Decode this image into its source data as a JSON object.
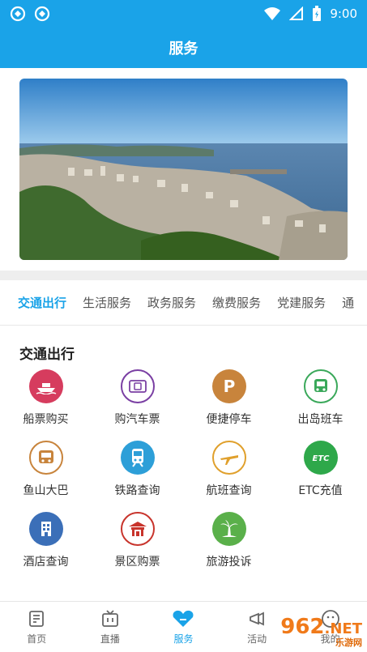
{
  "status": {
    "time": "9:00"
  },
  "header": {
    "title": "服务"
  },
  "tabs": [
    "交通出行",
    "生活服务",
    "政务服务",
    "缴费服务",
    "党建服务",
    "通"
  ],
  "section": {
    "title": "交通出行"
  },
  "services": [
    {
      "label": "船票购买",
      "icon": "ship-icon",
      "color": "#d63c5e"
    },
    {
      "label": "购汽车票",
      "icon": "bus-ticket-icon",
      "color": "#7a3fa3"
    },
    {
      "label": "便捷停车",
      "icon": "parking-icon",
      "color": "#c8843c"
    },
    {
      "label": "出岛班车",
      "icon": "shuttle-bus-icon",
      "color": "#3aa85a"
    },
    {
      "label": "鱼山大巴",
      "icon": "coach-icon",
      "color": "#c8843c"
    },
    {
      "label": "铁路查询",
      "icon": "train-icon",
      "color": "#2d9fd8"
    },
    {
      "label": "航班查询",
      "icon": "plane-icon",
      "color": "#e0a02c"
    },
    {
      "label": "ETC充值",
      "icon": "etc-icon",
      "color": "#2ea84a"
    },
    {
      "label": "酒店查询",
      "icon": "hotel-icon",
      "color": "#3b6fb8"
    },
    {
      "label": "景区购票",
      "icon": "scenic-icon",
      "color": "#c8342c"
    },
    {
      "label": "旅游投诉",
      "icon": "palm-icon",
      "color": "#5ab04a"
    }
  ],
  "nav": [
    {
      "label": "首页",
      "icon": "home-icon"
    },
    {
      "label": "直播",
      "icon": "tv-icon"
    },
    {
      "label": "服务",
      "icon": "service-icon"
    },
    {
      "label": "活动",
      "icon": "activity-icon"
    },
    {
      "label": "我的",
      "icon": "user-icon"
    }
  ],
  "watermark": {
    "text": "962",
    "suffix": ".NET",
    "sub": "乐游网"
  }
}
